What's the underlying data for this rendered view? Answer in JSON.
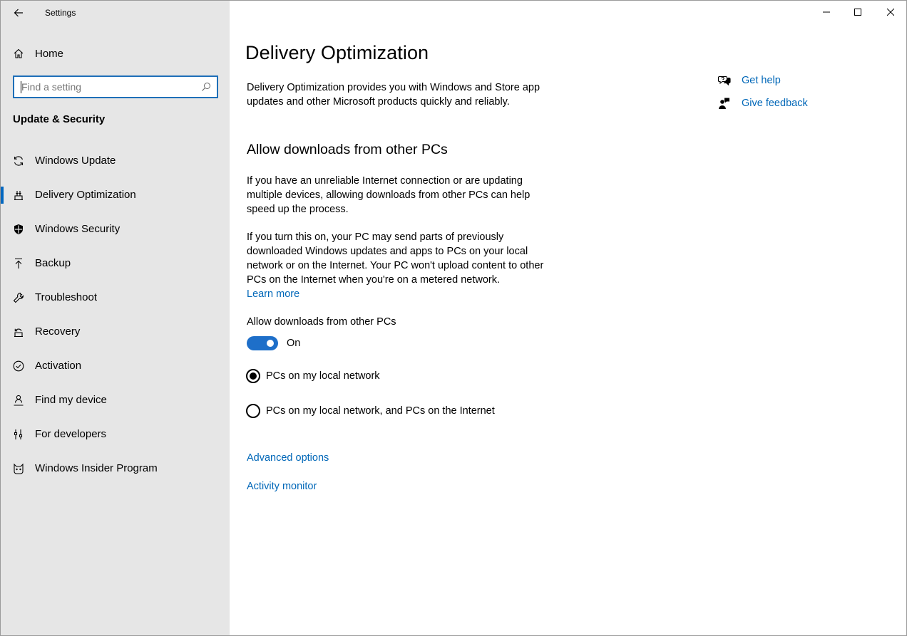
{
  "window": {
    "title": "Settings"
  },
  "sidebar": {
    "home_label": "Home",
    "search": {
      "placeholder": "Find a setting",
      "value": ""
    },
    "section_title": "Update & Security",
    "items": [
      {
        "label": "Windows Update",
        "icon": "sync-icon",
        "selected": false
      },
      {
        "label": "Delivery Optimization",
        "icon": "delivery-optimization-icon",
        "selected": true
      },
      {
        "label": "Windows Security",
        "icon": "shield-icon",
        "selected": false
      },
      {
        "label": "Backup",
        "icon": "backup-arrow-icon",
        "selected": false
      },
      {
        "label": "Troubleshoot",
        "icon": "wrench-icon",
        "selected": false
      },
      {
        "label": "Recovery",
        "icon": "recovery-icon",
        "selected": false
      },
      {
        "label": "Activation",
        "icon": "check-circle-icon",
        "selected": false
      },
      {
        "label": "Find my device",
        "icon": "person-location-icon",
        "selected": false
      },
      {
        "label": "For developers",
        "icon": "developer-tools-icon",
        "selected": false
      },
      {
        "label": "Windows Insider Program",
        "icon": "insider-cat-icon",
        "selected": false
      }
    ]
  },
  "main": {
    "title": "Delivery Optimization",
    "intro": [
      "Delivery Optimization provides you with Windows and Store app",
      "updates and other Microsoft products quickly and reliably."
    ],
    "section_heading": "Allow downloads from other PCs",
    "para1": [
      "If you have an unreliable Internet connection or are updating",
      "multiple devices, allowing downloads from other PCs can help",
      "speed up the process."
    ],
    "para2": [
      "If you turn this on, your PC may send parts of previously",
      "downloaded Windows updates and apps to PCs on your local",
      "network or on the Internet. Your PC won't upload content to other",
      "PCs on the Internet when you're on a metered network."
    ],
    "learn_more": "Learn more",
    "toggle": {
      "label": "Allow downloads from other PCs",
      "state_text": "On",
      "on": true
    },
    "radio_options": [
      {
        "label": "PCs on my local network",
        "checked": true
      },
      {
        "label": "PCs on my local network, and PCs on the Internet",
        "checked": false
      }
    ],
    "advanced_options": "Advanced options",
    "activity_monitor": "Activity monitor"
  },
  "help": {
    "get_help": "Get help",
    "give_feedback": "Give feedback"
  },
  "colors": {
    "accent": "#0067b8",
    "toggle_on": "#1e6fc9",
    "sidebar_bg": "#e6e6e6"
  }
}
